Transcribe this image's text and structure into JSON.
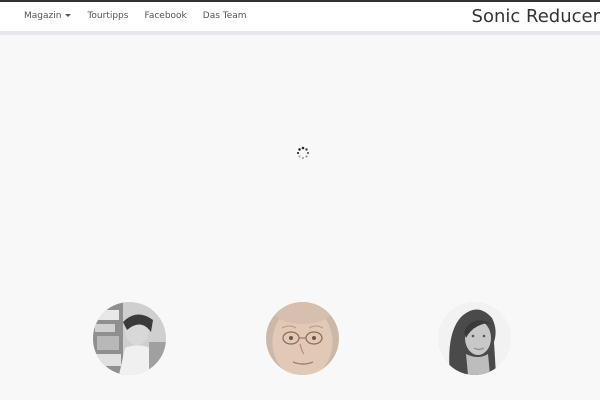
{
  "navbar": {
    "items": [
      {
        "label": "Magazin",
        "has_dropdown": true,
        "icon": "caret-down-icon"
      },
      {
        "label": "Tourtipps"
      },
      {
        "label": "Facebook"
      },
      {
        "label": "Das Team"
      }
    ],
    "brand": "Sonic Reducer"
  },
  "loader": {
    "icon": "loading-spinner-icon"
  },
  "team": {
    "avatars": [
      {
        "name": "team-member-1-avatar"
      },
      {
        "name": "team-member-2-avatar"
      },
      {
        "name": "team-member-3-avatar"
      }
    ]
  },
  "colors": {
    "background": "#f8f8f8",
    "navbar": "#ffffff",
    "nav_text": "#555555",
    "brand_text": "#333333"
  }
}
